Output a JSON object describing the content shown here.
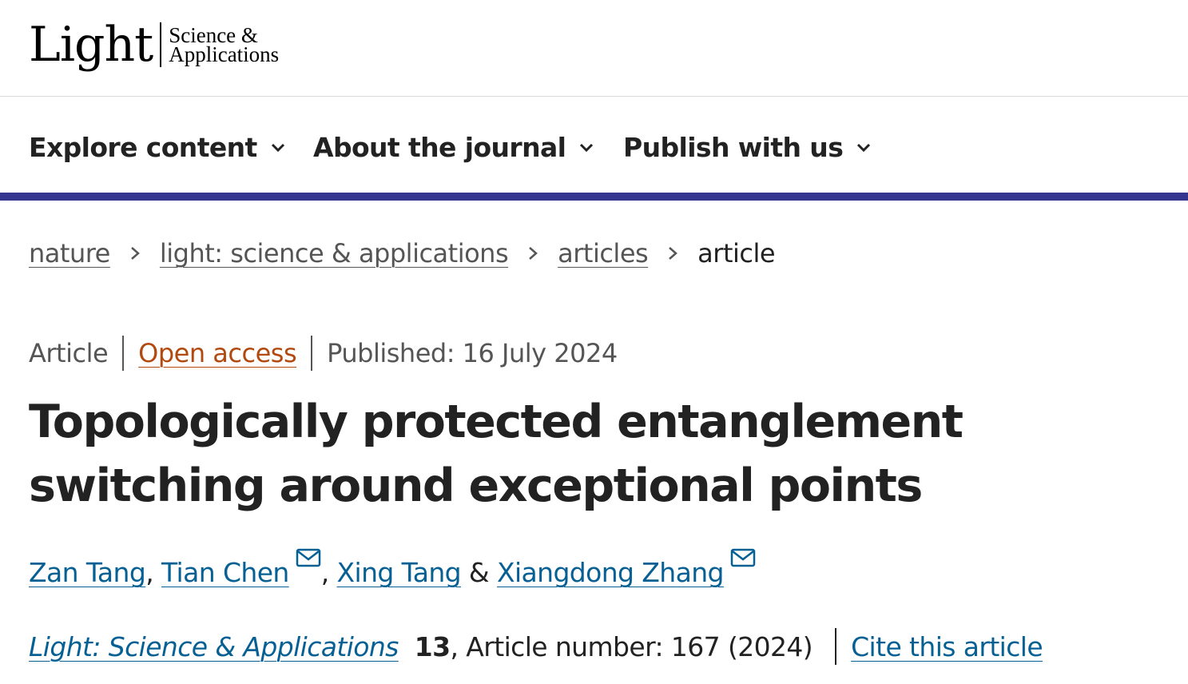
{
  "logo": {
    "main": "Light",
    "sub_line1": "Science &",
    "sub_line2": "Applications"
  },
  "nav": {
    "items": [
      {
        "label": "Explore content"
      },
      {
        "label": "About the journal"
      },
      {
        "label": "Publish with us"
      }
    ],
    "accent_color": "#33358f"
  },
  "breadcrumb": {
    "items": [
      {
        "label": "nature"
      },
      {
        "label": "light: science & applications"
      },
      {
        "label": "articles"
      }
    ],
    "current": "article"
  },
  "article": {
    "type": "Article",
    "access": "Open access",
    "published": "Published: 16 July 2024",
    "title": "Topologically protected entanglement switching around exceptional points",
    "authors": [
      {
        "name": "Zan Tang"
      },
      {
        "name": "Tian Chen",
        "email_icon": "mail-icon"
      },
      {
        "name": "Xing Tang"
      },
      {
        "name": "Xiangdong Zhang",
        "email_icon": "mail-icon"
      }
    ],
    "author_separators": [
      ", ",
      ", ",
      " & "
    ],
    "journal": "Light: Science & Applications",
    "volume": "13",
    "article_number": ", Article number: 167 (2024)",
    "cite_label": "Cite this article",
    "link_color": "#066094",
    "open_access_color": "#b24a10"
  }
}
